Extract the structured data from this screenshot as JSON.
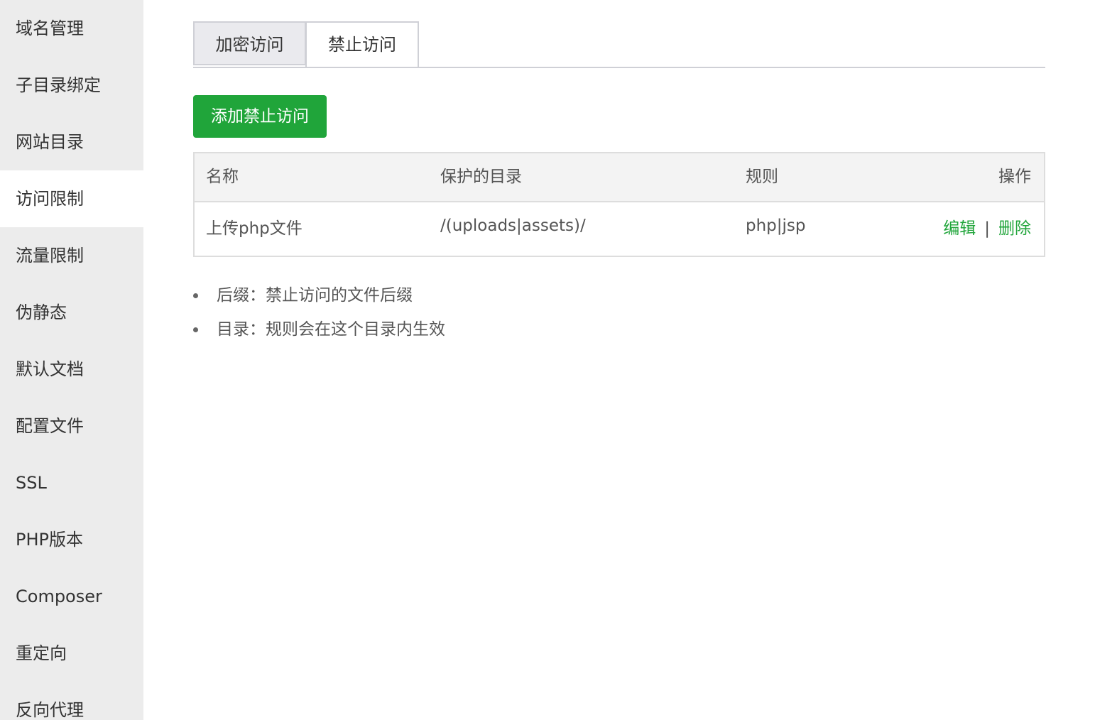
{
  "sidebar": {
    "items": [
      {
        "label": "域名管理"
      },
      {
        "label": "子目录绑定"
      },
      {
        "label": "网站目录"
      },
      {
        "label": "访问限制",
        "active": true
      },
      {
        "label": "流量限制"
      },
      {
        "label": "伪静态"
      },
      {
        "label": "默认文档"
      },
      {
        "label": "配置文件"
      },
      {
        "label": "SSL"
      },
      {
        "label": "PHP版本"
      },
      {
        "label": "Composer"
      },
      {
        "label": "重定向"
      },
      {
        "label": "反向代理"
      }
    ]
  },
  "tabs": [
    {
      "label": "加密访问"
    },
    {
      "label": "禁止访问",
      "active": true
    }
  ],
  "add_button": {
    "label": "添加禁止访问"
  },
  "table": {
    "headers": {
      "name": "名称",
      "dir": "保护的目录",
      "rule": "规则",
      "op": "操作"
    },
    "rows": [
      {
        "name": "上传php文件",
        "dir": "/(uploads|assets)/",
        "rule": "php|jsp",
        "edit": "编辑",
        "sep": "|",
        "delete": "删除"
      }
    ]
  },
  "notes": [
    "后缀：禁止访问的文件后缀",
    "目录：规则会在这个目录内生效"
  ],
  "colors": {
    "accent": "#20a53a",
    "sidebar_bg": "#ececec",
    "header_bg": "#f3f3f3"
  }
}
